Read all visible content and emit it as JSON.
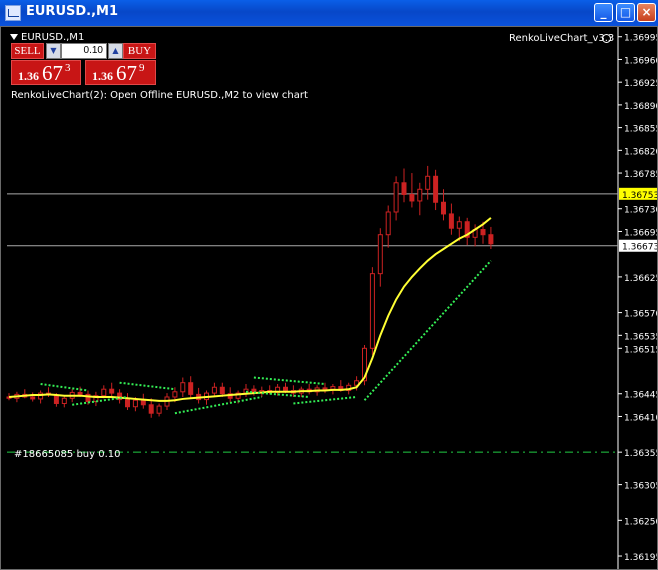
{
  "window": {
    "title": "EURUSD.,M1",
    "controls": [
      "minimize",
      "maximize",
      "close"
    ]
  },
  "chart_header": {
    "symbol_label": "EURUSD.,M1",
    "indicator_name": "RenkoLiveChart_v3.3",
    "message": "RenkoLiveChart(2): Open Offline EURUSD.,M2 to view chart"
  },
  "trade_panel": {
    "sell_label": "SELL",
    "buy_label": "BUY",
    "lots": "0.10",
    "sell_price": {
      "prefix": "1.36",
      "big": "67",
      "super": "3"
    },
    "buy_price": {
      "prefix": "1.36",
      "big": "67",
      "super": "9"
    }
  },
  "order": {
    "label": "#18665085 buy 0.10",
    "price": 1.36355,
    "color": "#22cc44"
  },
  "colors": {
    "candle": "#cc2222",
    "ma": "#ffff33",
    "dots": "#33ee55",
    "ask_highlight": "#ffff00",
    "hline": "#aaaaaa"
  },
  "chart_data": {
    "type": "candlestick",
    "symbol": "EURUSD.",
    "timeframe": "M1",
    "ylim": [
      1.36175,
      1.3701
    ],
    "y_ticks": [
      "1.36995",
      "1.36960",
      "1.36925",
      "1.36890",
      "1.36855",
      "1.36820",
      "1.36785",
      "1.36730",
      "1.36695",
      "1.36625",
      "1.36570",
      "1.36535",
      "1.36515",
      "1.36445",
      "1.36410",
      "1.36355",
      "1.36305",
      "1.36250",
      "1.36195"
    ],
    "current_ask_label": "1.36753",
    "current_ask": 1.36753,
    "current_bid_label": "1.36673",
    "current_bid": 1.36673,
    "candles": [
      [
        1.3644,
        1.36446,
        1.36435,
        1.36438
      ],
      [
        1.36438,
        1.36448,
        1.36432,
        1.36444
      ],
      [
        1.36444,
        1.36452,
        1.36438,
        1.3644
      ],
      [
        1.3644,
        1.36447,
        1.36433,
        1.36437
      ],
      [
        1.36437,
        1.3645,
        1.3643,
        1.36446
      ],
      [
        1.36446,
        1.36455,
        1.3644,
        1.36443
      ],
      [
        1.36443,
        1.36446,
        1.36425,
        1.3643
      ],
      [
        1.3643,
        1.36442,
        1.36424,
        1.36438
      ],
      [
        1.36438,
        1.36452,
        1.36432,
        1.36447
      ],
      [
        1.36447,
        1.36456,
        1.3644,
        1.36444
      ],
      [
        1.36444,
        1.3645,
        1.36428,
        1.36433
      ],
      [
        1.36433,
        1.36448,
        1.36426,
        1.36442
      ],
      [
        1.36442,
        1.36458,
        1.36438,
        1.36452
      ],
      [
        1.36452,
        1.36462,
        1.3644,
        1.36446
      ],
      [
        1.36446,
        1.36452,
        1.3643,
        1.36436
      ],
      [
        1.36436,
        1.36446,
        1.3642,
        1.36425
      ],
      [
        1.36425,
        1.3644,
        1.36418,
        1.36435
      ],
      [
        1.36435,
        1.36445,
        1.36422,
        1.36428
      ],
      [
        1.36428,
        1.36438,
        1.36408,
        1.36415
      ],
      [
        1.36415,
        1.3643,
        1.3641,
        1.36426
      ],
      [
        1.36426,
        1.36446,
        1.3642,
        1.3644
      ],
      [
        1.3644,
        1.36455,
        1.36432,
        1.36448
      ],
      [
        1.36448,
        1.3647,
        1.3644,
        1.36462
      ],
      [
        1.36462,
        1.36472,
        1.36438,
        1.36444
      ],
      [
        1.36444,
        1.36454,
        1.3643,
        1.36436
      ],
      [
        1.36436,
        1.3645,
        1.36428,
        1.36446
      ],
      [
        1.36446,
        1.36462,
        1.3644,
        1.36455
      ],
      [
        1.36455,
        1.36462,
        1.3644,
        1.36445
      ],
      [
        1.36445,
        1.36455,
        1.36432,
        1.36438
      ],
      [
        1.36438,
        1.3645,
        1.3643,
        1.36446
      ],
      [
        1.36446,
        1.3646,
        1.3644,
        1.36452
      ],
      [
        1.36452,
        1.36458,
        1.36442,
        1.36448
      ],
      [
        1.36448,
        1.36456,
        1.3644,
        1.3645
      ],
      [
        1.3645,
        1.36458,
        1.36444,
        1.36447
      ],
      [
        1.36447,
        1.3646,
        1.36442,
        1.36455
      ],
      [
        1.36455,
        1.36462,
        1.36446,
        1.3645
      ],
      [
        1.3645,
        1.36458,
        1.3644,
        1.36446
      ],
      [
        1.36446,
        1.36456,
        1.3644,
        1.36452
      ],
      [
        1.36452,
        1.3646,
        1.36444,
        1.36448
      ],
      [
        1.36448,
        1.36458,
        1.36442,
        1.36454
      ],
      [
        1.36454,
        1.36462,
        1.36446,
        1.36452
      ],
      [
        1.36452,
        1.3646,
        1.36444,
        1.36456
      ],
      [
        1.36456,
        1.36466,
        1.36448,
        1.3645
      ],
      [
        1.3645,
        1.36462,
        1.36444,
        1.36458
      ],
      [
        1.36458,
        1.36472,
        1.3645,
        1.36465
      ],
      [
        1.36465,
        1.3652,
        1.36458,
        1.36515
      ],
      [
        1.36515,
        1.3664,
        1.36505,
        1.3663
      ],
      [
        1.3663,
        1.367,
        1.3661,
        1.3669
      ],
      [
        1.3669,
        1.36735,
        1.3667,
        1.36725
      ],
      [
        1.36725,
        1.3678,
        1.36712,
        1.3677
      ],
      [
        1.3677,
        1.36792,
        1.3674,
        1.36752
      ],
      [
        1.36752,
        1.36785,
        1.36732,
        1.36742
      ],
      [
        1.36742,
        1.3677,
        1.3672,
        1.3676
      ],
      [
        1.3676,
        1.36796,
        1.36744,
        1.3678
      ],
      [
        1.3678,
        1.3679,
        1.36728,
        1.3674
      ],
      [
        1.3674,
        1.3676,
        1.36712,
        1.36722
      ],
      [
        1.36722,
        1.36738,
        1.3669,
        1.367
      ],
      [
        1.367,
        1.36718,
        1.3668,
        1.3671
      ],
      [
        1.3671,
        1.36716,
        1.36674,
        1.36686
      ],
      [
        1.36686,
        1.36706,
        1.36672,
        1.36698
      ],
      [
        1.36698,
        1.3671,
        1.36676,
        1.3669
      ],
      [
        1.3669,
        1.36702,
        1.36668,
        1.36676
      ]
    ],
    "ma_values": [
      1.3644,
      1.36441,
      1.36442,
      1.36443,
      1.36443,
      1.36444,
      1.36443,
      1.36442,
      1.36442,
      1.36442,
      1.36441,
      1.3644,
      1.3644,
      1.3644,
      1.36439,
      1.36438,
      1.36437,
      1.36436,
      1.36435,
      1.36434,
      1.36434,
      1.36435,
      1.36437,
      1.36438,
      1.36439,
      1.3644,
      1.36441,
      1.36442,
      1.36443,
      1.36444,
      1.36445,
      1.36446,
      1.36447,
      1.36448,
      1.36448,
      1.36448,
      1.36448,
      1.36449,
      1.36449,
      1.3645,
      1.3645,
      1.36451,
      1.36451,
      1.36452,
      1.36455,
      1.3647,
      1.365,
      1.36535,
      1.36565,
      1.3659,
      1.3661,
      1.36625,
      1.36638,
      1.3665,
      1.3666,
      1.36668,
      1.36676,
      1.36684,
      1.3669,
      1.36698,
      1.36706,
      1.36716
    ],
    "dot_segments": [
      [
        [
          4,
          1.3646
        ],
        [
          10,
          1.3645
        ]
      ],
      [
        [
          8,
          1.36428
        ],
        [
          15,
          1.3644
        ]
      ],
      [
        [
          14,
          1.36462
        ],
        [
          21,
          1.36452
        ]
      ],
      [
        [
          21,
          1.36415
        ],
        [
          32,
          1.3644
        ]
      ],
      [
        [
          30,
          1.36448
        ],
        [
          38,
          1.3644
        ]
      ],
      [
        [
          31,
          1.3647
        ],
        [
          40,
          1.3646
        ]
      ],
      [
        [
          36,
          1.3643
        ],
        [
          44,
          1.3644
        ]
      ],
      [
        [
          45,
          1.36435
        ],
        [
          61,
          1.3665
        ]
      ]
    ]
  }
}
